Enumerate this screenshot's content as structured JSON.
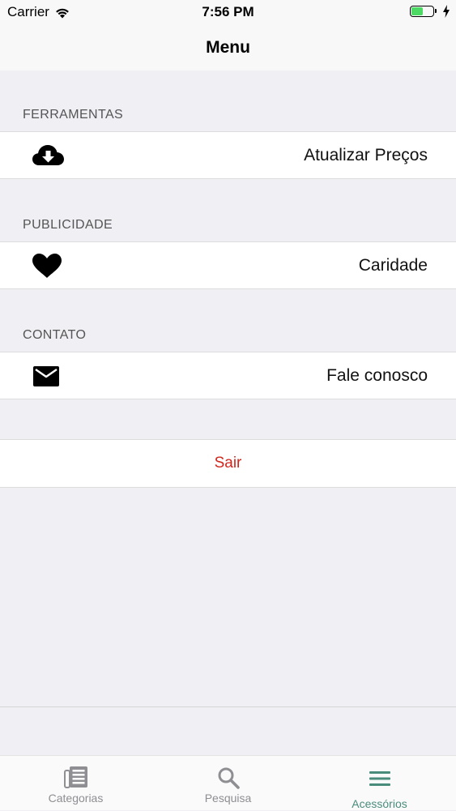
{
  "status_bar": {
    "carrier": "Carrier",
    "time": "7:56 PM",
    "battery_color": "#4cd964",
    "battery_level": 0.55
  },
  "nav": {
    "title": "Menu"
  },
  "sections": [
    {
      "header": "FERRAMENTAS",
      "row": {
        "label": "Atualizar Preços",
        "icon": "cloud-download-icon"
      }
    },
    {
      "header": "PUBLICIDADE",
      "row": {
        "label": "Caridade",
        "icon": "heart-icon"
      }
    },
    {
      "header": "CONTATO",
      "row": {
        "label": "Fale conosco",
        "icon": "envelope-icon"
      }
    }
  ],
  "signout": {
    "label": "Sair",
    "color": "#d0271d"
  },
  "tabs": [
    {
      "label": "Categorias",
      "icon": "newspaper-icon",
      "active": false
    },
    {
      "label": "Pesquisa",
      "icon": "search-icon",
      "active": false
    },
    {
      "label": "Acessórios",
      "icon": "hamburger-menu-icon",
      "active": true
    }
  ],
  "colors": {
    "tab_active": "#4a8c7c",
    "tab_inactive": "#8e8e93"
  }
}
